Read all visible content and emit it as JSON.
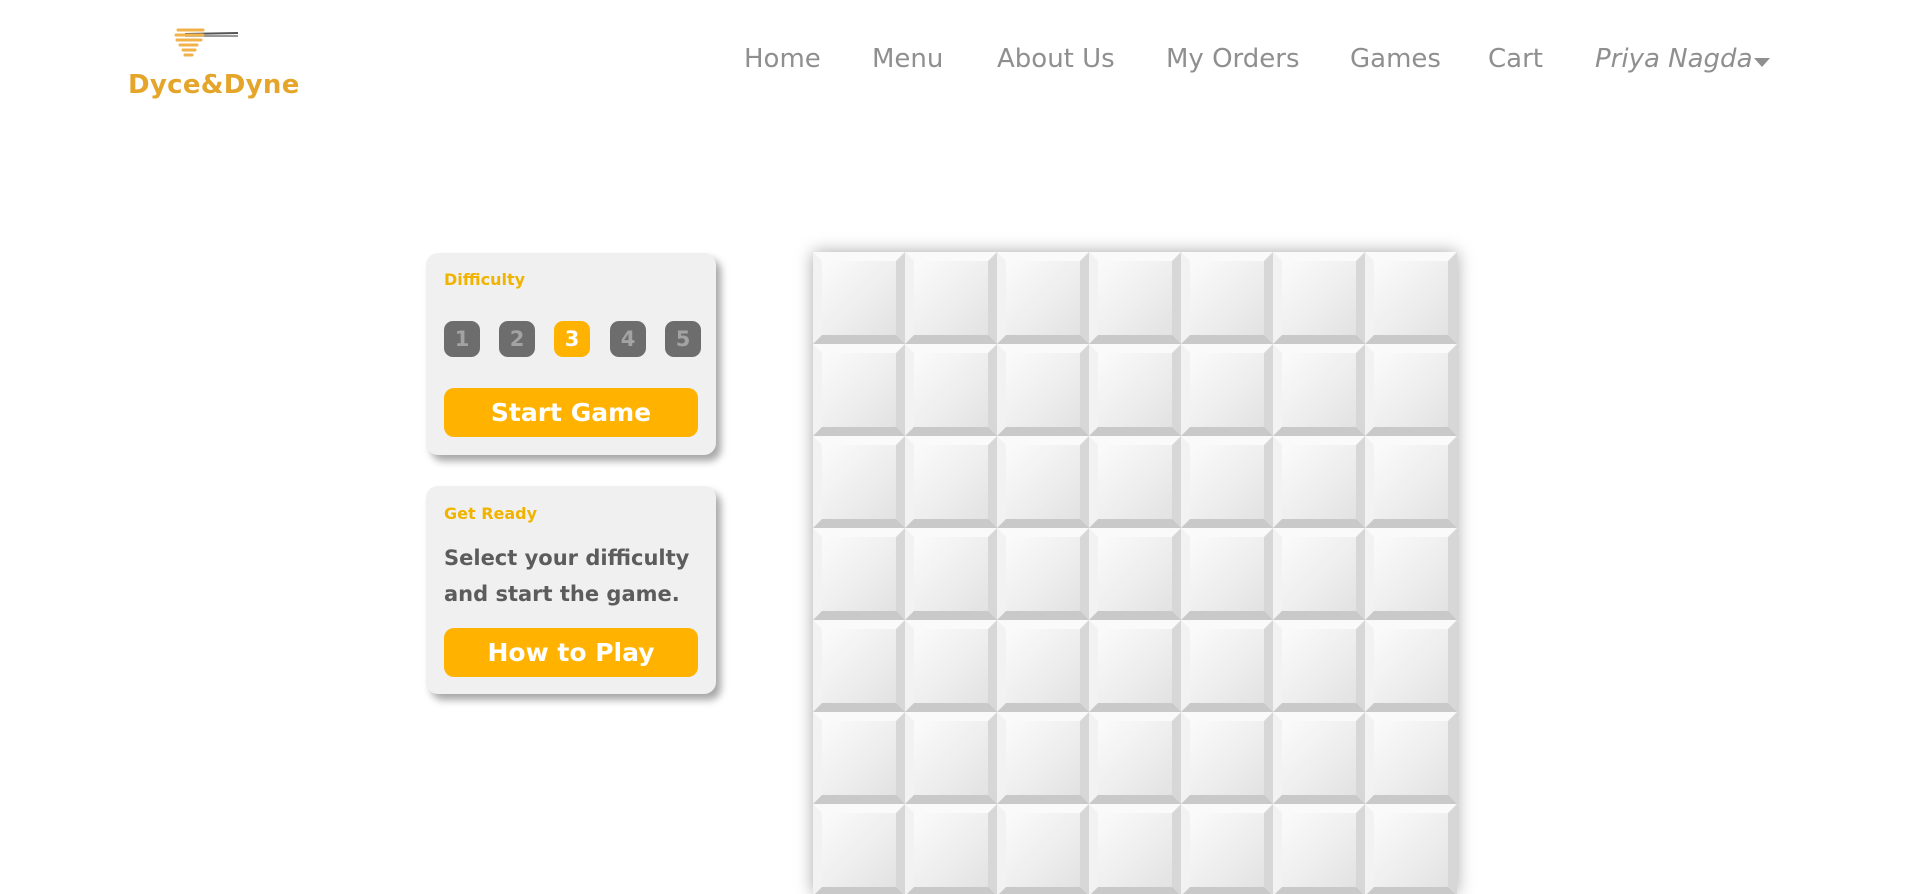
{
  "brand": {
    "name": "Dyce&Dyne"
  },
  "nav": {
    "items": [
      "Home",
      "Menu",
      "About Us",
      "My Orders",
      "Games",
      "Cart"
    ],
    "user": "Priya Nagda"
  },
  "difficulty_panel": {
    "heading": "Difficulty",
    "levels": [
      "1",
      "2",
      "3",
      "4",
      "5"
    ],
    "selected": "3",
    "start_label": "Start Game"
  },
  "status_panel": {
    "heading": "Get Ready",
    "message": "Select your difficulty and start the game.",
    "help_label": "How to Play"
  },
  "board": {
    "rows": 7,
    "cols": 7
  },
  "colors": {
    "accent": "#ffb300",
    "brand": "#e4a52a",
    "nav_text": "#8f8f8f",
    "level_inactive": "#6d6d6d"
  }
}
